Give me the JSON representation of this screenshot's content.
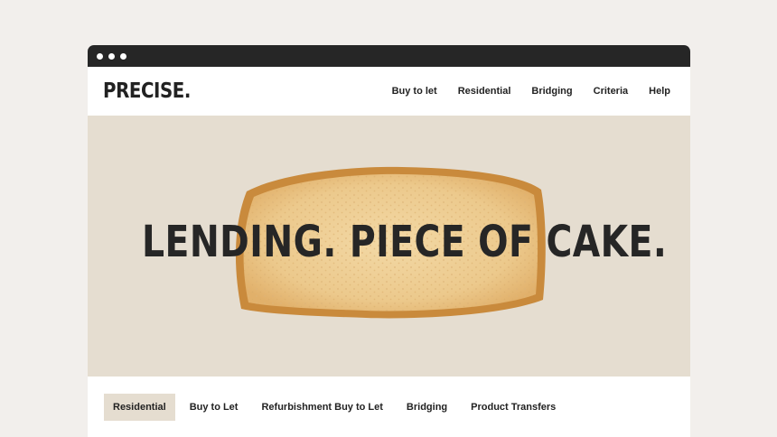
{
  "window": {
    "dots": 3
  },
  "brand": {
    "logo": "PRECISE."
  },
  "nav": {
    "items": [
      {
        "label": "Buy to let"
      },
      {
        "label": "Residential"
      },
      {
        "label": "Bridging"
      },
      {
        "label": "Criteria"
      },
      {
        "label": "Help"
      }
    ]
  },
  "hero": {
    "headline": "LENDING. PIECE OF CAKE.",
    "background": "#e5ddd0",
    "image": "cake-slice"
  },
  "tabs": {
    "items": [
      {
        "label": "Residential",
        "active": true
      },
      {
        "label": "Buy to Let",
        "active": false
      },
      {
        "label": "Refurbishment Buy to Let",
        "active": false
      },
      {
        "label": "Bridging",
        "active": false
      },
      {
        "label": "Product Transfers",
        "active": false
      }
    ]
  },
  "colors": {
    "page_bg": "#f2efec",
    "titlebar": "#262626",
    "text": "#222222",
    "active_tab_bg": "#e5ddd0"
  }
}
